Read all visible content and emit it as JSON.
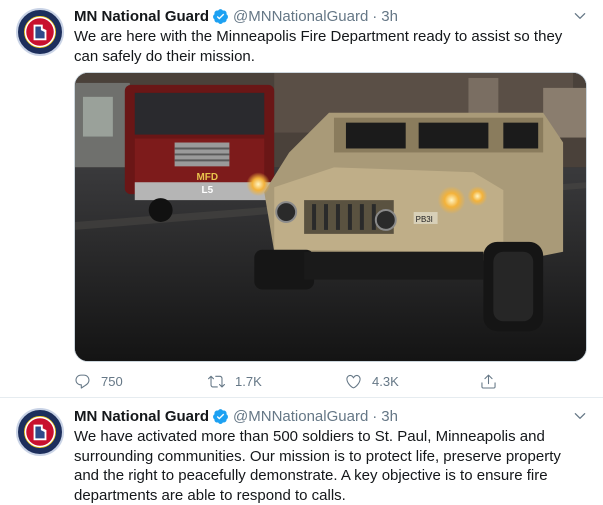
{
  "tweets": [
    {
      "author_name": "MN National Guard",
      "handle": "@MNNationalGuard",
      "separator": "·",
      "time": "3h",
      "text": "We are here with the Minneapolis Fire Department ready to assist so they can safely do their mission.",
      "media": {
        "truck_lettering": "MFD",
        "truck_number": "L5",
        "humvee_plate": "PB3I"
      },
      "replies": "750",
      "retweets": "1.7K",
      "likes": "4.3K"
    },
    {
      "author_name": "MN National Guard",
      "handle": "@MNNationalGuard",
      "separator": "·",
      "time": "3h",
      "text": "We have activated more than 500 soldiers to St. Paul, Minneapolis and surrounding communities. Our mission is to protect life, preserve property and the right to peacefully demonstrate. A key objective is to ensure fire departments are able to respond to calls."
    }
  ],
  "colors": {
    "text_primary": "#14171a",
    "text_secondary": "#657786",
    "verified_blue": "#1da1f2",
    "divider": "#e6ecf0"
  },
  "icons": {
    "verified": "verified-badge-icon",
    "caret": "chevron-down-icon",
    "reply": "reply-icon",
    "retweet": "retweet-icon",
    "like": "heart-icon",
    "share": "share-icon"
  }
}
